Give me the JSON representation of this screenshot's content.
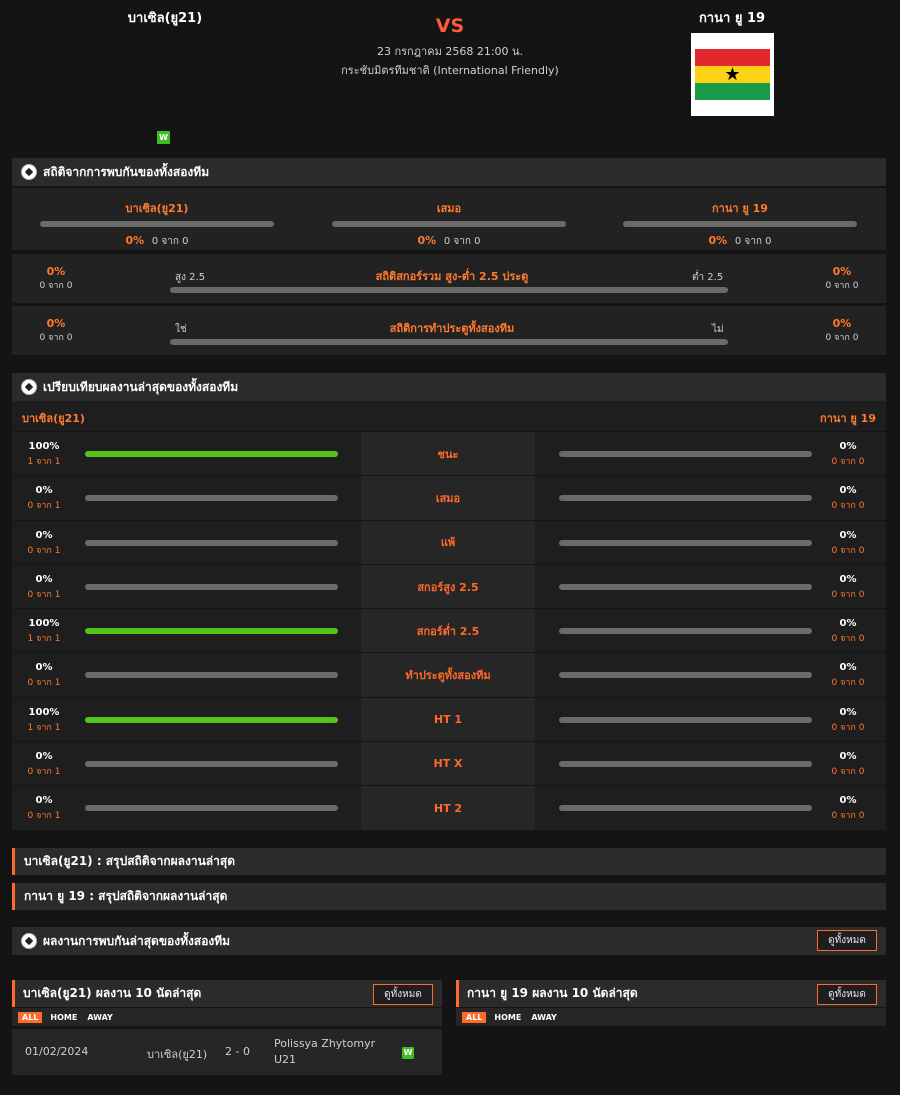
{
  "match": {
    "home": "บาเซิล(ยู21)",
    "away": "กานา ยู 19",
    "vs": "VS",
    "date": "23 กรกฎาคม 2568 21:00 น.",
    "league": "กระชับมิตรทีมชาติ (International Friendly)",
    "home_form": [
      "W"
    ]
  },
  "h2h": {
    "title": "สถิติจากการพบกันของทั้งสองทีม",
    "cols": [
      {
        "label": "บาเซิล(ยู21)",
        "pct": "0%",
        "of": "0 จาก 0",
        "value": 0
      },
      {
        "label": "เสมอ",
        "pct": "0%",
        "of": "0 จาก 0",
        "value": 0
      },
      {
        "label": "กานา ยู 19",
        "pct": "0%",
        "of": "0 จาก 0",
        "value": 0
      }
    ],
    "over_under": {
      "title": "สถิติสกอร์รวม สูง-ต่ำ 2.5 ประตู",
      "left_label": "สูง 2.5",
      "right_label": "ต่ำ 2.5",
      "left_pct": "0%",
      "left_of": "0 จาก 0",
      "right_pct": "0%",
      "right_of": "0 จาก 0"
    },
    "btts": {
      "title": "สถิติการทำประตูทั้งสองทีม",
      "left_label": "ใช่",
      "right_label": "ไม่",
      "left_pct": "0%",
      "left_of": "0 จาก 0",
      "right_pct": "0%",
      "right_of": "0 จาก 0"
    }
  },
  "compare": {
    "title": "เปรียบเทียบผลงานล่าสุดของทั้งสองทีม",
    "home": "บาเซิล(ยู21)",
    "away": "กานา ยู 19",
    "rows": [
      {
        "label": "ชนะ",
        "home_pct": "100%",
        "home_of": "1 จาก 1",
        "home_val": 1,
        "away_pct": "0%",
        "away_of": "0 จาก 0",
        "away_val": 0
      },
      {
        "label": "เสมอ",
        "home_pct": "0%",
        "home_of": "0 จาก 1",
        "home_val": 0,
        "away_pct": "0%",
        "away_of": "0 จาก 0",
        "away_val": 0
      },
      {
        "label": "แพ้",
        "home_pct": "0%",
        "home_of": "0 จาก 1",
        "home_val": 0,
        "away_pct": "0%",
        "away_of": "0 จาก 0",
        "away_val": 0
      },
      {
        "label": "สกอร์สูง 2.5",
        "home_pct": "0%",
        "home_of": "0 จาก 1",
        "home_val": 0,
        "away_pct": "0%",
        "away_of": "0 จาก 0",
        "away_val": 0
      },
      {
        "label": "สกอร์ต่ำ 2.5",
        "home_pct": "100%",
        "home_of": "1 จาก 1",
        "home_val": 1,
        "away_pct": "0%",
        "away_of": "0 จาก 0",
        "away_val": 0
      },
      {
        "label": "ทำประตูทั้งสองทีม",
        "home_pct": "0%",
        "home_of": "0 จาก 1",
        "home_val": 0,
        "away_pct": "0%",
        "away_of": "0 จาก 0",
        "away_val": 0
      },
      {
        "label": "HT 1",
        "home_pct": "100%",
        "home_of": "1 จาก 1",
        "home_val": 1,
        "away_pct": "0%",
        "away_of": "0 จาก 0",
        "away_val": 0
      },
      {
        "label": "HT X",
        "home_pct": "0%",
        "home_of": "0 จาก 1",
        "home_val": 0,
        "away_pct": "0%",
        "away_of": "0 จาก 0",
        "away_val": 0
      },
      {
        "label": "HT 2",
        "home_pct": "0%",
        "home_of": "0 จาก 1",
        "home_val": 0,
        "away_pct": "0%",
        "away_of": "0 จาก 0",
        "away_val": 0
      }
    ]
  },
  "summaries": {
    "home": "บาเซิล(ยู21) : สรุปสถิติจากผลงานล่าสุด",
    "away": "กานา ยู 19 : สรุปสถิติจากผลงานล่าสุด"
  },
  "recent_h2h": {
    "title": "ผลงานการพบกันล่าสุดของทั้งสองทีม",
    "view_all": "ดูทั้งหมด"
  },
  "home_last10": {
    "title": "บาเซิล(ยู21) ผลงาน 10 นัดล่าสุด",
    "view_all": "ดูทั้งหมด",
    "filters": [
      "ALL",
      "HOME",
      "AWAY"
    ],
    "matches": [
      {
        "date": "01/02/2024",
        "home": "บาเซิล(ยู21)",
        "score": "2 - 0",
        "away_line1": "Polissya Zhytomyr",
        "away_line2": "U21",
        "result": "W"
      }
    ]
  },
  "away_last10": {
    "title": "กานา ยู 19 ผลงาน 10 นัดล่าสุด",
    "view_all": "ดูทั้งหมด",
    "filters": [
      "ALL",
      "HOME",
      "AWAY"
    ]
  },
  "colors": {
    "accent": "#ff6a2a",
    "win": "#52c41a",
    "bar_empty": "#6a6a6a"
  }
}
